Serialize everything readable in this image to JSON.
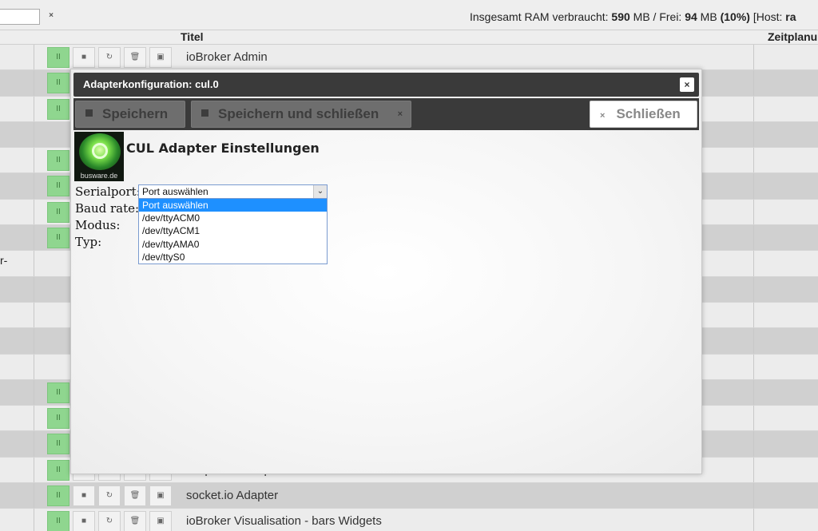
{
  "topbar": {
    "filter_value": "",
    "filter_clear": "×",
    "ram_prefix": "Insgesamt RAM verbraucht: ",
    "ram_used": "590",
    "ram_mb1": " MB / Frei: ",
    "ram_free": "94",
    "ram_mb2": " MB ",
    "ram_percent": "(10%)",
    "host_prefix": " [Host: ",
    "host_value": "ra"
  },
  "table": {
    "header_title": "Titel",
    "header_schedule": "Zeitplanu",
    "rows": [
      {
        "title": "ioBroker Admin",
        "left": "",
        "shade": "light",
        "controls": true
      },
      {
        "title": "",
        "left": "",
        "shade": "dark",
        "controls": true
      },
      {
        "title": "",
        "left": "",
        "shade": "light",
        "controls": true
      },
      {
        "title": "",
        "left": "",
        "shade": "dark",
        "controls": false
      },
      {
        "title": "",
        "left": "",
        "shade": "light",
        "controls": true
      },
      {
        "title": "",
        "left": "",
        "shade": "dark",
        "controls": true
      },
      {
        "title": "",
        "left": "",
        "shade": "light",
        "controls": true
      },
      {
        "title": "",
        "left": "",
        "shade": "dark",
        "controls": true
      },
      {
        "title": "",
        "left": "r-",
        "shade": "light",
        "controls": false
      },
      {
        "title": "",
        "left": "",
        "shade": "dark",
        "controls": false
      },
      {
        "title": "",
        "left": "",
        "shade": "light",
        "controls": false
      },
      {
        "title": "",
        "left": "",
        "shade": "dark",
        "controls": false
      },
      {
        "title": "",
        "left": "",
        "shade": "light",
        "controls": false
      },
      {
        "title": "",
        "left": "",
        "shade": "dark",
        "controls": true
      },
      {
        "title": "",
        "left": "",
        "shade": "light",
        "controls": true
      },
      {
        "title": "",
        "left": "",
        "shade": "dark",
        "controls": true
      },
      {
        "title": "simpleAPI Adapter",
        "left": "",
        "shade": "light",
        "controls": true
      },
      {
        "title": "socket.io Adapter",
        "left": "",
        "shade": "dark",
        "controls": true
      },
      {
        "title": "ioBroker Visualisation - bars Widgets",
        "left": "",
        "shade": "light",
        "controls": true
      }
    ]
  },
  "modal": {
    "title": "Adapterkonfiguration: cul.0",
    "close_icon": "×",
    "toolbar": {
      "save_label": "Speichern",
      "save_close_label": "Speichern und schließen",
      "save_close_x": "×",
      "close_label": "Schließen",
      "close_x": "×"
    },
    "logo_brand": "busware.de",
    "settings_title": "CUL Adapter Einstellungen",
    "form": {
      "serialport_label": "Serialport:",
      "baud_label": "Baud rate:",
      "mode_label": "Modus:",
      "type_label": "Typ:",
      "serial_selected": "Port auswählen",
      "serial_options": [
        "Port auswählen",
        "/dev/ttyACM0",
        "/dev/ttyACM1",
        "/dev/ttyAMA0",
        "/dev/ttyS0"
      ]
    }
  },
  "colors": {
    "accent_green": "#8fd68f",
    "title_bar": "#3a3a3a",
    "selection_blue": "#1e90ff"
  }
}
